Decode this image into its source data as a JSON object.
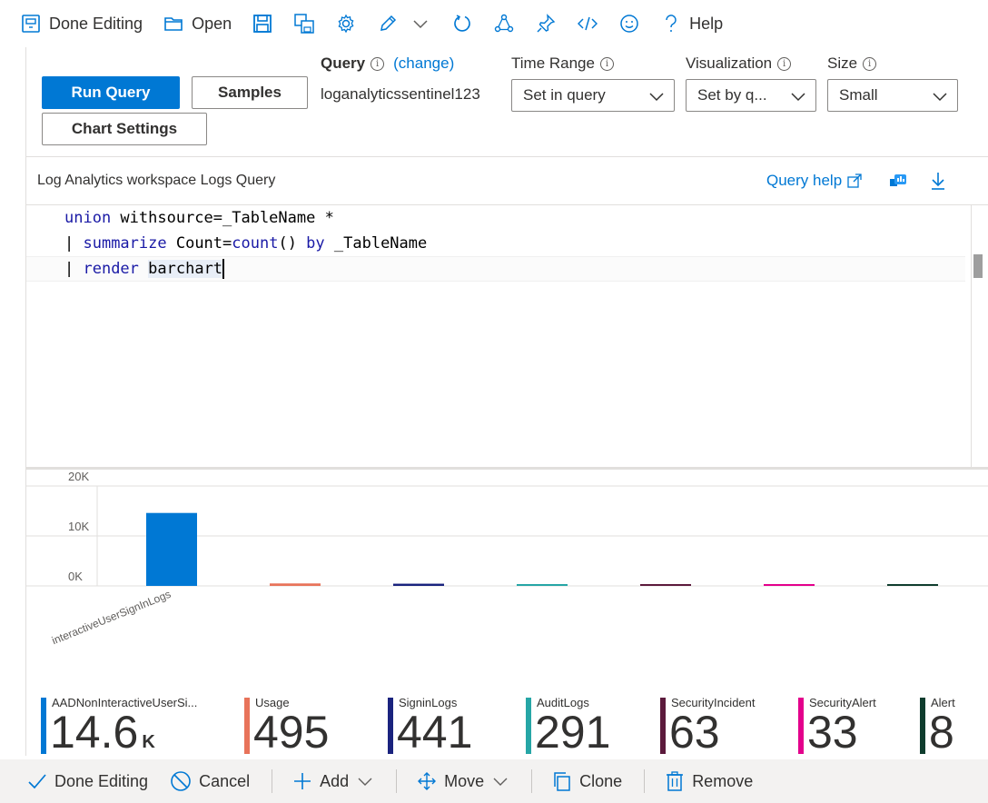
{
  "toolbar": {
    "done_editing": "Done Editing",
    "open": "Open",
    "help": "Help",
    "icons": [
      "pin-board-icon",
      "folder-open-icon",
      "save-icon",
      "save-as-icon",
      "gear-icon",
      "pencil-icon",
      "chevron-down-icon",
      "refresh-icon",
      "share-icon",
      "pin-icon",
      "code-icon",
      "smiley-icon",
      "question-icon"
    ]
  },
  "query_controls": {
    "run_query": "Run Query",
    "samples": "Samples",
    "chart_settings": "Chart Settings",
    "query_label": "Query",
    "change_link": "(change)",
    "workspace": "loganalyticssentinel123",
    "time_range_label": "Time Range",
    "time_range_value": "Set in query",
    "visualization_label": "Visualization",
    "visualization_value": "Set by q...",
    "size_label": "Size",
    "size_value": "Small",
    "info_glyph": "i"
  },
  "query_header": {
    "title": "Log Analytics workspace Logs Query",
    "help_link": "Query help"
  },
  "editor": {
    "line1_a": "union",
    "line1_b": " withsource=_TableName *",
    "line2_pipe": "| ",
    "line2_kw": "summarize",
    "line2_b": " Count=",
    "line2_fn": "count",
    "line2_c": "() ",
    "line2_kw2": "by",
    "line2_d": " _TableName",
    "line3_pipe": "| ",
    "line3_kw": "render",
    "line3_b": " ",
    "line3_c": "barchart"
  },
  "chart_data": {
    "type": "bar",
    "yticks": [
      "20K",
      "10K",
      "0K"
    ],
    "ylim": [
      0,
      20000
    ],
    "x_label_visible": "interactiveUserSignInLogs",
    "categories": [
      "AADNonInteractiveUserSi...",
      "Usage",
      "SigninLogs",
      "AuditLogs",
      "SecurityIncident",
      "SecurityAlert",
      "Alert"
    ],
    "values": [
      14600,
      495,
      441,
      291,
      63,
      33,
      8
    ],
    "display_values": [
      "14.6",
      "495",
      "441",
      "291",
      "63",
      "33",
      "8"
    ],
    "display_suffix": [
      "K",
      "",
      "",
      "",
      "",
      "",
      ""
    ],
    "colors": [
      "#0078d4",
      "#e8735a",
      "#1a237e",
      "#26a6a6",
      "#5c1a3c",
      "#e3008c",
      "#0f3d2e"
    ]
  },
  "bottom_bar": {
    "done_editing": "Done Editing",
    "cancel": "Cancel",
    "add": "Add",
    "move": "Move",
    "clone": "Clone",
    "remove": "Remove"
  }
}
